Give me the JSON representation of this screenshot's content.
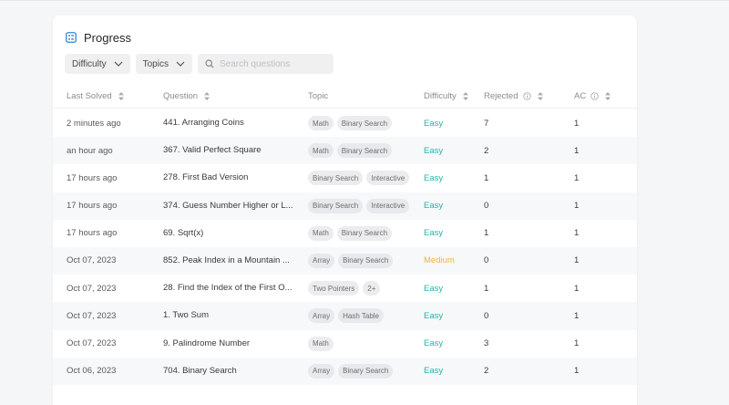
{
  "header": {
    "title": "Progress",
    "icon": "list-icon"
  },
  "filters": {
    "difficulty_label": "Difficulty",
    "topics_label": "Topics",
    "search_placeholder": "Search questions"
  },
  "columns": {
    "last_solved": "Last Solved",
    "question": "Question",
    "topic": "Topic",
    "difficulty": "Difficulty",
    "rejected": "Rejected",
    "ac": "AC"
  },
  "colors": {
    "easy": "#1fb8a6",
    "medium": "#f5b335"
  },
  "rows": [
    {
      "last_solved": "2 minutes ago",
      "question": "441. Arranging Coins",
      "topics": [
        "Math",
        "Binary Search"
      ],
      "difficulty": "Easy",
      "rejected": "7",
      "ac": "1"
    },
    {
      "last_solved": "an hour ago",
      "question": "367. Valid Perfect Square",
      "topics": [
        "Math",
        "Binary Search"
      ],
      "difficulty": "Easy",
      "rejected": "2",
      "ac": "1"
    },
    {
      "last_solved": "17 hours ago",
      "question": "278. First Bad Version",
      "topics": [
        "Binary Search",
        "Interactive"
      ],
      "difficulty": "Easy",
      "rejected": "1",
      "ac": "1"
    },
    {
      "last_solved": "17 hours ago",
      "question": "374. Guess Number Higher or L...",
      "topics": [
        "Binary Search",
        "Interactive"
      ],
      "difficulty": "Easy",
      "rejected": "0",
      "ac": "1"
    },
    {
      "last_solved": "17 hours ago",
      "question": "69. Sqrt(x)",
      "topics": [
        "Math",
        "Binary Search"
      ],
      "difficulty": "Easy",
      "rejected": "1",
      "ac": "1"
    },
    {
      "last_solved": "Oct 07, 2023",
      "question": "852. Peak Index in a Mountain ...",
      "topics": [
        "Array",
        "Binary Search"
      ],
      "difficulty": "Medium",
      "rejected": "0",
      "ac": "1"
    },
    {
      "last_solved": "Oct 07, 2023",
      "question": "28. Find the Index of the First O...",
      "topics": [
        "Two Pointers",
        "2+"
      ],
      "difficulty": "Easy",
      "rejected": "1",
      "ac": "1"
    },
    {
      "last_solved": "Oct 07, 2023",
      "question": "1. Two Sum",
      "topics": [
        "Array",
        "Hash Table"
      ],
      "difficulty": "Easy",
      "rejected": "0",
      "ac": "1"
    },
    {
      "last_solved": "Oct 07, 2023",
      "question": "9. Palindrome Number",
      "topics": [
        "Math"
      ],
      "difficulty": "Easy",
      "rejected": "3",
      "ac": "1"
    },
    {
      "last_solved": "Oct 06, 2023",
      "question": "704. Binary Search",
      "topics": [
        "Array",
        "Binary Search"
      ],
      "difficulty": "Easy",
      "rejected": "2",
      "ac": "1"
    }
  ]
}
